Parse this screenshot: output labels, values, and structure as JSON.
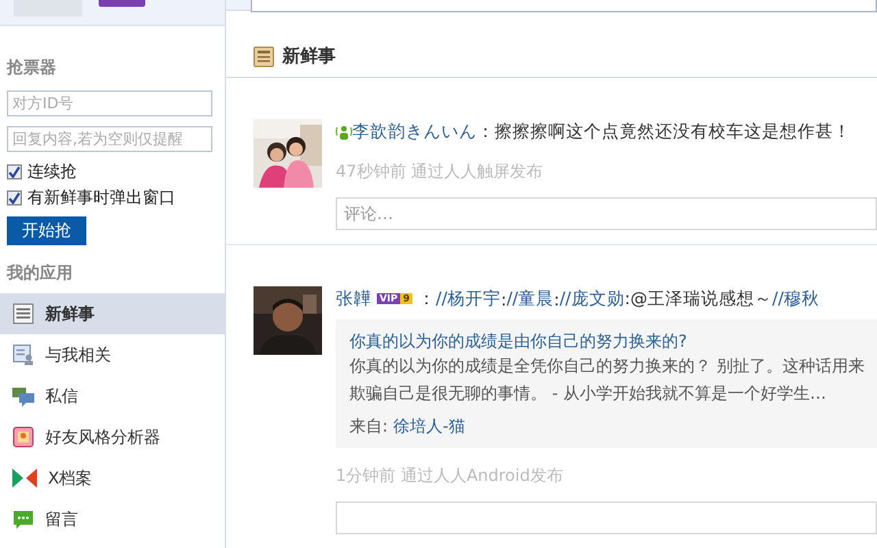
{
  "sidebar": {
    "grabber": {
      "title": "抢票器",
      "fields": [
        {
          "placeholder": "对方ID号"
        },
        {
          "placeholder": "回复内容,若为空则仅提醒"
        }
      ],
      "options": [
        {
          "label": "连续抢",
          "checked": true
        },
        {
          "label": "有新鲜事时弹出窗口",
          "checked": true
        }
      ],
      "button": "开始抢"
    },
    "apps_title": "我的应用",
    "apps": [
      {
        "kind": "news",
        "label": "新鲜事",
        "selected": true
      },
      {
        "kind": "related",
        "label": "与我相关",
        "selected": false
      },
      {
        "kind": "message",
        "label": "私信",
        "selected": false
      },
      {
        "kind": "analyzer",
        "label": "好友风格分析器",
        "selected": false
      },
      {
        "kind": "xfile",
        "label": "X档案",
        "selected": false
      },
      {
        "kind": "guestbook",
        "label": "留言",
        "selected": false
      }
    ]
  },
  "feed": {
    "title": "新鲜事",
    "posts": [
      {
        "mobile": true,
        "parts": [
          {
            "kind": "link",
            "text": "李歆韵きんいん"
          },
          {
            "kind": "text",
            "text": "：擦擦擦啊这个点竟然还没有校车这是想作甚！"
          }
        ],
        "meta": "47秒钟前   通过人人触屏发布",
        "comment_placeholder": "评论…"
      },
      {
        "mobile": false,
        "badge": {
          "label": "VIP",
          "level": "9"
        },
        "parts": [
          {
            "kind": "link",
            "text": "张韡"
          },
          {
            "kind": "text",
            "text": "："
          },
          {
            "kind": "link",
            "text": "//杨开宇"
          },
          {
            "kind": "text",
            "text": ":"
          },
          {
            "kind": "link",
            "text": "//童晨"
          },
          {
            "kind": "text",
            "text": ":"
          },
          {
            "kind": "link",
            "text": "//庞文勋"
          },
          {
            "kind": "text",
            "text": ":@王泽瑞说感想～"
          },
          {
            "kind": "link",
            "text": "//穆秋"
          }
        ],
        "quote": {
          "title": "你真的以为你的成绩是由你自己的努力换来的?",
          "lines": [
            "你真的以为你的成绩是全凭你自己的努力换来的？ 别扯了。这种话用来",
            "欺骗自己是很无聊的事情。 - 从小学开始我就不算是一个好学生…"
          ],
          "source_label": "来自:",
          "source": "徐培人-猫"
        },
        "meta": "1分钟前 通过人人Android发布"
      }
    ]
  }
}
